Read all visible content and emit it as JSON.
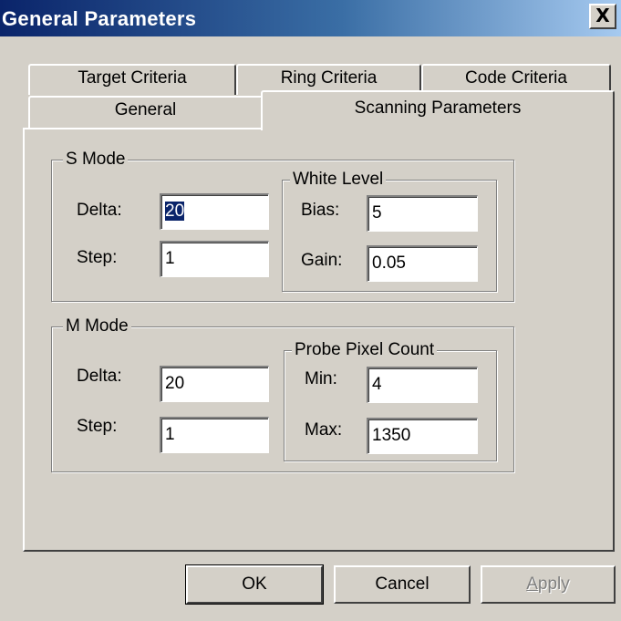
{
  "window": {
    "title": "General Parameters",
    "close_label": "X"
  },
  "tabs": {
    "back_row": [
      "Target Criteria",
      "Ring Criteria",
      "Code Criteria"
    ],
    "front_row": [
      "General",
      "Scanning Parameters"
    ],
    "selected": "Scanning Parameters"
  },
  "s_mode": {
    "title": "S Mode",
    "delta_label": "Delta:",
    "delta_value": "20",
    "step_label": "Step:",
    "step_value": "1",
    "white_level": {
      "title": "White Level",
      "bias_label": "Bias:",
      "bias_value": "5",
      "gain_label": "Gain:",
      "gain_value": "0.05"
    }
  },
  "m_mode": {
    "title": "M Mode",
    "delta_label": "Delta:",
    "delta_value": "20",
    "step_label": "Step:",
    "step_value": "1",
    "probe_pixel_count": {
      "title": "Probe Pixel Count",
      "min_label": "Min:",
      "min_value": "4",
      "max_label": "Max:",
      "max_value": "1350"
    }
  },
  "buttons": {
    "ok": "OK",
    "cancel": "Cancel",
    "apply_mnemonic": "A",
    "apply_rest": "pply"
  }
}
